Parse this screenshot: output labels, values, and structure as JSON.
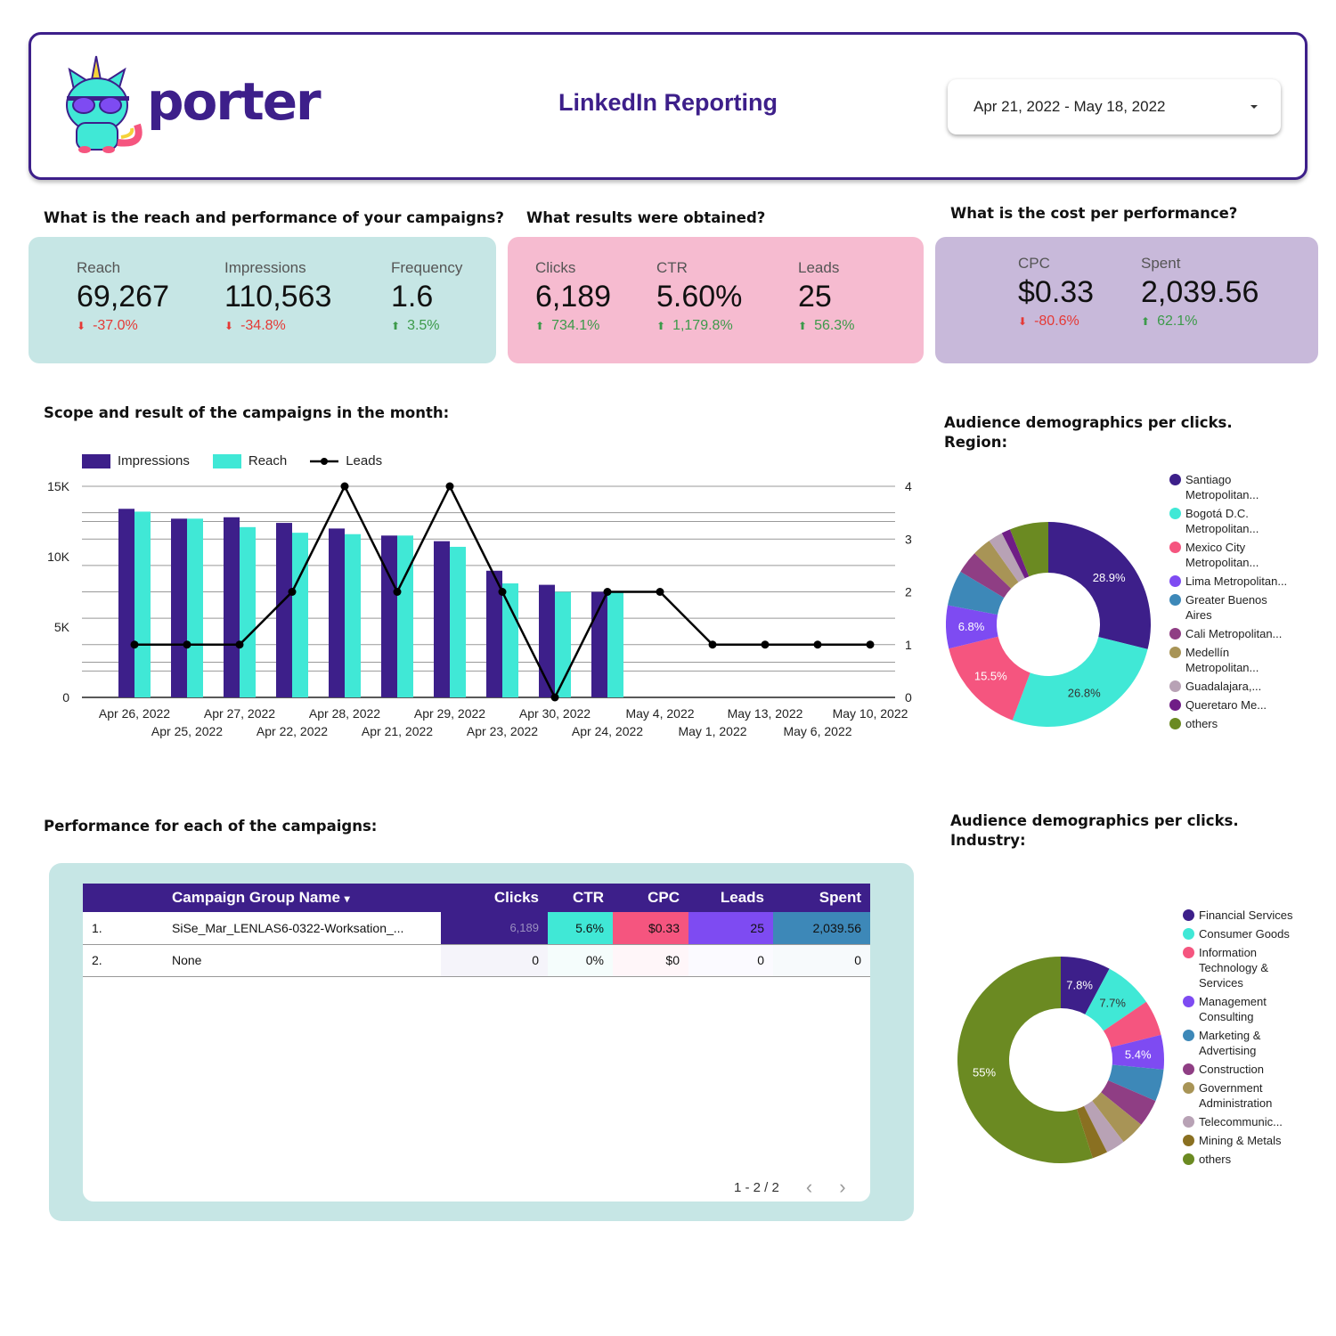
{
  "header": {
    "brand": "porter",
    "title": "LinkedIn Reporting",
    "date_range": "Apr 21, 2022 - May 18, 2022"
  },
  "colors": {
    "brand_purple": "#3d1f8a",
    "teal": "#40e8d6",
    "pink": "#f5557f",
    "violet": "#7e4bf2",
    "steel_blue": "#3d88b8",
    "plum": "#8f3e84",
    "khaki": "#a89456",
    "mauve": "#b8a2b5",
    "dark_purple": "#6f1d86",
    "olive": "#6b8a22",
    "mustard": "#8a7021",
    "card_teal": "#c6e6e5",
    "card_pink": "#f6bbd0",
    "card_lavender": "#c8b9da",
    "down": "#e53935",
    "up": "#3c9a4a"
  },
  "sections": {
    "reach": {
      "question": "What is the reach and performance of your campaigns?",
      "kpis": [
        {
          "label": "Reach",
          "value": "69,267",
          "delta": "-37.0%",
          "direction": "down"
        },
        {
          "label": "Impressions",
          "value": "110,563",
          "delta": "-34.8%",
          "direction": "down"
        },
        {
          "label": "Frequency",
          "value": "1.6",
          "delta": "3.5%",
          "direction": "up"
        }
      ]
    },
    "results": {
      "question": "What results were obtained?",
      "kpis": [
        {
          "label": "Clicks",
          "value": "6,189",
          "delta": "734.1%",
          "direction": "up"
        },
        {
          "label": "CTR",
          "value": "5.60%",
          "delta": "1,179.8%",
          "direction": "up"
        },
        {
          "label": "Leads",
          "value": "25",
          "delta": "56.3%",
          "direction": "up"
        }
      ]
    },
    "cost": {
      "question": "What is the cost per performance?",
      "kpis": [
        {
          "label": "CPC",
          "value": "$0.33",
          "delta": "-80.6%",
          "direction": "down"
        },
        {
          "label": "Spent",
          "value": "2,039.56",
          "delta": "62.1%",
          "direction": "up"
        }
      ]
    },
    "scope_title": "Scope and result of the campaigns in the month:",
    "region_title_1": "Audience demographics per clicks.",
    "region_title_2": "Region:",
    "industry_title_1": "Audience demographics per clicks.",
    "industry_title_2": "Industry:",
    "table_title": "Performance for each of the campaigns:"
  },
  "chart_data": [
    {
      "type": "bar",
      "title": "Scope and result of the campaigns in the month:",
      "categories": [
        "Apr 26, 2022",
        "Apr 25, 2022",
        "Apr 27, 2022",
        "Apr 22, 2022",
        "Apr 28, 2022",
        "Apr 21, 2022",
        "Apr 29, 2022",
        "Apr 23, 2022",
        "Apr 30, 2022",
        "Apr 24, 2022",
        "May 4, 2022",
        "May 1, 2022",
        "May 13, 2022",
        "May 6, 2022",
        "May 10, 2022"
      ],
      "series": [
        {
          "name": "Impressions",
          "type": "bar",
          "axis": "left",
          "color": "#3d1f8a",
          "values": [
            13400,
            12700,
            12800,
            12400,
            12000,
            11500,
            11100,
            9000,
            8000,
            7500,
            0,
            0,
            0,
            0,
            0
          ]
        },
        {
          "name": "Reach",
          "type": "bar",
          "axis": "left",
          "color": "#40e8d6",
          "values": [
            13200,
            12700,
            12100,
            11700,
            11600,
            11500,
            10700,
            8100,
            7500,
            7500,
            0,
            0,
            0,
            0,
            0
          ]
        },
        {
          "name": "Leads",
          "type": "line",
          "axis": "right",
          "color": "#000000",
          "values": [
            1,
            1,
            1,
            2,
            4,
            2,
            4,
            2,
            0,
            2,
            2,
            1,
            1,
            1,
            1
          ]
        }
      ],
      "y_left": {
        "ticks": [
          "0",
          "5K",
          "10K",
          "15K"
        ],
        "range": [
          0,
          15000
        ]
      },
      "y_right": {
        "ticks": [
          "0",
          "1",
          "2",
          "3",
          "4"
        ],
        "range": [
          0,
          4
        ]
      },
      "legend": "top-left",
      "grid": true
    },
    {
      "type": "pie",
      "title": "Audience demographics per clicks. Region:",
      "donut": true,
      "legend": "right",
      "slices": [
        {
          "label": "Santiago Metropolitan...",
          "value": 28.9,
          "display": "28.9%",
          "color": "#3d1f8a"
        },
        {
          "label": "Bogotá D.C. Metropolitan...",
          "value": 26.8,
          "display": "26.8%",
          "color": "#40e8d6"
        },
        {
          "label": "Mexico City Metropolitan...",
          "value": 15.5,
          "display": "15.5%",
          "color": "#f5557f"
        },
        {
          "label": "Lima Metropolitan...",
          "value": 6.8,
          "display": "6.8%",
          "color": "#7e4bf2"
        },
        {
          "label": "Greater Buenos Aires",
          "value": 5.6,
          "display": "",
          "color": "#3d88b8"
        },
        {
          "label": "Cali Metropolitan...",
          "value": 3.6,
          "display": "",
          "color": "#8f3e84"
        },
        {
          "label": "Medellín Metropolitan...",
          "value": 3.0,
          "display": "",
          "color": "#a89456"
        },
        {
          "label": "Guadalajara,...",
          "value": 2.3,
          "display": "",
          "color": "#b8a2b5"
        },
        {
          "label": "Queretaro Me...",
          "value": 1.4,
          "display": "",
          "color": "#6f1d86"
        },
        {
          "label": "others",
          "value": 6.1,
          "display": "",
          "color": "#6b8a22"
        }
      ]
    },
    {
      "type": "pie",
      "title": "Audience demographics per clicks. Industry:",
      "donut": true,
      "legend": "right",
      "slices": [
        {
          "label": "Financial Services",
          "value": 7.8,
          "display": "7.8%",
          "color": "#3d1f8a"
        },
        {
          "label": "Consumer Goods",
          "value": 7.7,
          "display": "7.7%",
          "color": "#40e8d6"
        },
        {
          "label": "Information Technology & Services",
          "value": 5.6,
          "display": "",
          "color": "#f5557f"
        },
        {
          "label": "Management Consulting",
          "value": 5.4,
          "display": "5.4%",
          "color": "#7e4bf2"
        },
        {
          "label": "Marketing & Advertising",
          "value": 5.0,
          "display": "",
          "color": "#3d88b8"
        },
        {
          "label": "Construction",
          "value": 4.3,
          "display": "",
          "color": "#8f3e84"
        },
        {
          "label": "Government Administration",
          "value": 3.8,
          "display": "",
          "color": "#a89456"
        },
        {
          "label": "Telecommunic...",
          "value": 3.0,
          "display": "",
          "color": "#b8a2b5"
        },
        {
          "label": "Mining & Metals",
          "value": 2.4,
          "display": "",
          "color": "#8a7021"
        },
        {
          "label": "others",
          "value": 55.0,
          "display": "55%",
          "color": "#6b8a22"
        }
      ]
    }
  ],
  "table": {
    "columns": [
      "",
      "Campaign Group Name",
      "Clicks",
      "CTR",
      "CPC",
      "Leads",
      "Spent"
    ],
    "sort_indicator": "▾",
    "rows": [
      {
        "index": "1.",
        "name": "SiSe_Mar_LENLAS6-0322-Worksation_...",
        "clicks": "6,189",
        "ctr": "5.6%",
        "cpc": "$0.33",
        "leads": "25",
        "spent": "2,039.56"
      },
      {
        "index": "2.",
        "name": "None",
        "clicks": "0",
        "ctr": "0%",
        "cpc": "$0",
        "leads": "0",
        "spent": "0"
      }
    ],
    "pagination": "1 - 2 / 2"
  }
}
